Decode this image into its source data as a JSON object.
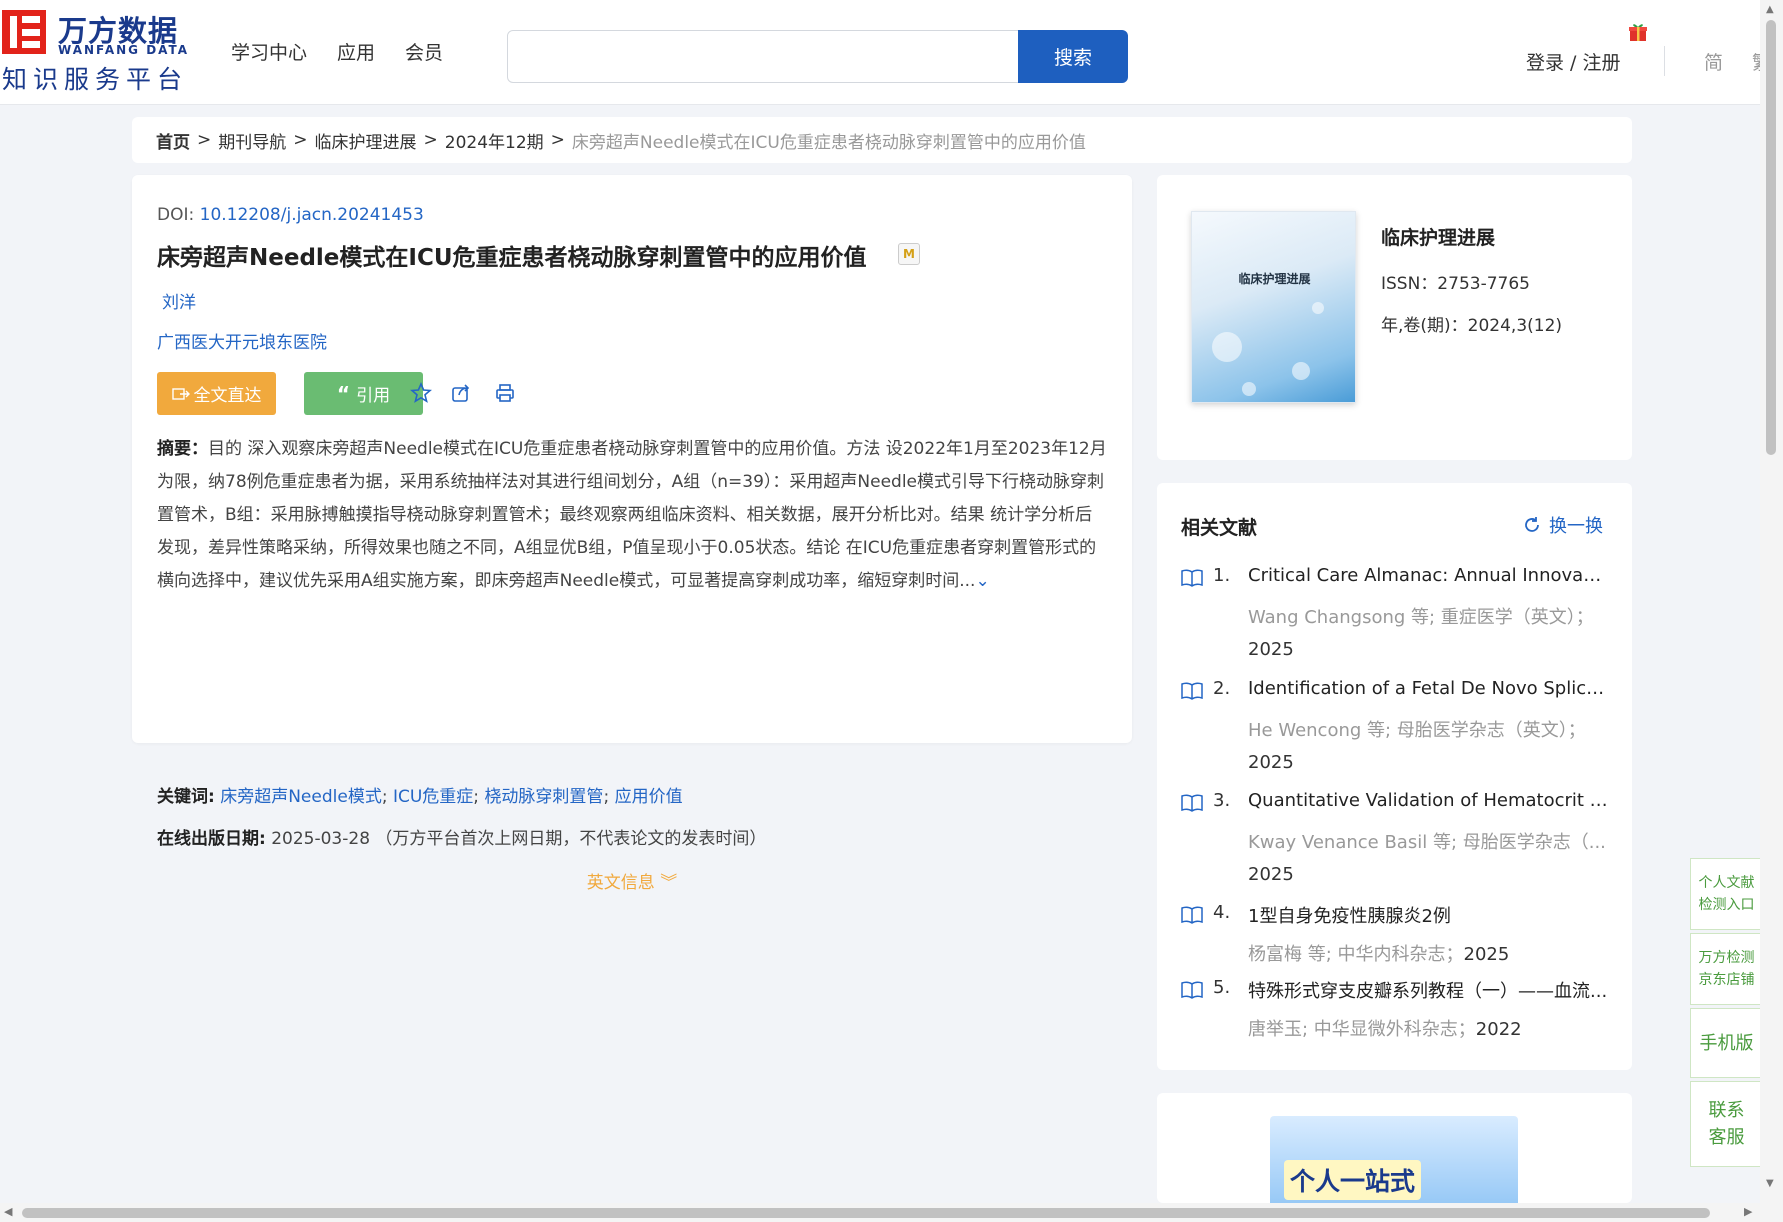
{
  "header": {
    "logo": {
      "cn": "万方数据",
      "en": "WANFANG DATA",
      "sub": "知识服务平台"
    },
    "nav": [
      "学习中心",
      "应用",
      "会员"
    ],
    "search": {
      "placeholder": "",
      "button": "搜索"
    },
    "login": "登录 / 注册",
    "lang_simplified": "简",
    "lang_traditional": "繁"
  },
  "breadcrumb": {
    "items": [
      "首页",
      "期刊导航",
      "临床护理进展",
      "2024年12期"
    ],
    "current": "床旁超声Needle模式在ICU危重症患者桡动脉穿刺置管中的应用价值",
    "separator": ">"
  },
  "article": {
    "doi_label": "DOI: ",
    "doi": "10.12208/j.jacn.20241453",
    "title": "床旁超声Needle模式在ICU危重症患者桡动脉穿刺置管中的应用价值",
    "author": "刘洋",
    "organization": "广西医大开元埌东医院",
    "fulltext_label": "全文直达",
    "cite_label": "引用",
    "abstract_label": "摘要：",
    "abstract": "目的 深入观察床旁超声Needle模式在ICU危重症患者桡动脉穿刺置管中的应用价值。方法 设2022年1月至2023年12月为限，纳78例危重症患者为据，采用系统抽样法对其进行组间划分，A组（n=39）：采用超声Needle模式引导下行桡动脉穿刺置管术，B组：采用脉搏触摸指导桡动脉穿刺置管术；最终观察两组临床资料、相关数据，展开分析比对。结果 统计学分析后发现，差异性策略采纳，所得效果也随之不同，A组显优B组，P值呈现小于0.05状态。结论 在ICU危重症患者穿刺置管形式的横向选择中，建议优先采用A组实施方案，即床旁超声Needle模式，可显著提高穿刺成功率，缩短穿刺时间...",
    "keywords_label": "关键词:",
    "keywords": [
      "床旁超声Needle模式",
      "ICU危重症",
      "桡动脉穿刺置管",
      "应用价值"
    ],
    "keyword_sep": ";",
    "pubdate_label": "在线出版日期:",
    "pubdate": "2025-03-28",
    "pubdate_note": "（万方平台首次上网日期，不代表论文的发表时间）",
    "english_info": "英文信息"
  },
  "journal": {
    "cover_title": "临床护理进展",
    "name": "临床护理进展",
    "issn": "ISSN：2753-7765",
    "volume": "年,卷(期)：2024,3(12)"
  },
  "related": {
    "title": "相关文献",
    "refresh": "换一换",
    "items": [
      {
        "num": "1.",
        "title": "Critical Care Almanac: Annual Innovation...",
        "meta": "Wang Changsong  等;  重症医学（英文）；",
        "year": "2025"
      },
      {
        "num": "2.",
        "title": "Identification of a Fetal De Novo Splice ...",
        "meta": "He Wencong  等;  母胎医学杂志（英文）；",
        "year": "2025"
      },
      {
        "num": "3.",
        "title": "Quantitative Validation of Hematocrit Pe...",
        "meta": "Kway Venance Basil  等;  母胎医学杂志（...",
        "year": "2025"
      },
      {
        "num": "4.",
        "title": "1型自身免疫性胰腺炎2例",
        "meta": "杨富梅  等;  中华内科杂志；",
        "year": "2025"
      },
      {
        "num": "5.",
        "title": "特殊形式穿支皮瓣系列教程（一）——血流...",
        "meta": "唐举玉; 中华显微外科杂志；",
        "year": "2022"
      }
    ]
  },
  "ad": {
    "text": "个人一站式"
  },
  "float_bar": {
    "check_entry": "个人文献检测入口",
    "jd_store": "万方检测京东店铺",
    "mobile": "手机版",
    "contact": "联系客服"
  }
}
